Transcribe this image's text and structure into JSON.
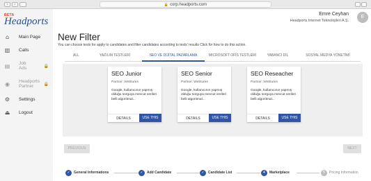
{
  "browser": {
    "url": "corp.headports.com"
  },
  "sidebar": {
    "logo_badge": "BETA",
    "logo_name": "Headports",
    "items": [
      {
        "label": "Main Page",
        "icon": "home-icon",
        "locked": false
      },
      {
        "label": "Calls",
        "icon": "bar-chart-icon",
        "locked": false
      },
      {
        "label": "Job Ads",
        "icon": "briefcase-icon",
        "locked": true
      },
      {
        "label": "Headports Partner",
        "icon": "partner-icon",
        "locked": true
      },
      {
        "label": "Settings",
        "icon": "gear-icon",
        "locked": false
      },
      {
        "label": "Logout",
        "icon": "logout-icon",
        "locked": false
      }
    ]
  },
  "header": {
    "user_name": "Emre Ceyhan",
    "company": "Headports Internet Teknolojileri A.Ş.",
    "avatar_initial": "E"
  },
  "page": {
    "title": "New Filter",
    "subtitle": "You can choose tests for apply to candidates and filter candidates according to tests' results Click for how to do this action."
  },
  "tabs": [
    {
      "label": "ALL",
      "active": false
    },
    {
      "label": "YAZILIM TESTLERİ",
      "active": false
    },
    {
      "label": "SEO VE DİJİTAL PAZARLAMA",
      "active": true
    },
    {
      "label": "MICROSOFT OFİS TESTLERİ",
      "active": false
    },
    {
      "label": "YABANCI DİL",
      "active": false
    },
    {
      "label": "SOSYAL MEDYA YÖNETİMİ",
      "active": false
    }
  ],
  "cards": [
    {
      "title": "SEO Junior",
      "partner": "Partner: Webtures",
      "description": "Google, kullanıcının yapmış olduğu sorguya mevcut verileri belli algoritmal...",
      "details_label": "DETAILS",
      "use_label": "USE THIS"
    },
    {
      "title": "SEO Senior",
      "partner": "Partner: Webtures",
      "description": "Google, kullanıcının yapmış olduğu sorguya mevcut verileri belli algoritmal...",
      "details_label": "DETAILS",
      "use_label": "USE THIS"
    },
    {
      "title": "SEO Reseacher",
      "partner": "Partner: Webtures",
      "description": "Google, kullanıcının yapmış olduğu sorguya mevcut verileri belli algoritmal...",
      "details_label": "DETAILS",
      "use_label": "USE THIS"
    }
  ],
  "pagination": {
    "previous_label": "PREVIOUS",
    "next_label": "NEXT"
  },
  "steps": [
    {
      "label": "General Informations",
      "state": "done",
      "marker": "✓"
    },
    {
      "label": "Add Candidate",
      "state": "done",
      "marker": "✓"
    },
    {
      "label": "Candidate List",
      "state": "done",
      "marker": "✓"
    },
    {
      "label": "Marketplace",
      "state": "current",
      "marker": "4"
    },
    {
      "label": "Pricing Information",
      "state": "todo",
      "marker": "5"
    }
  ],
  "colors": {
    "accent": "#2f55a4",
    "sidebar_bg": "#f4f4f4",
    "panel_bg": "#efefef"
  }
}
